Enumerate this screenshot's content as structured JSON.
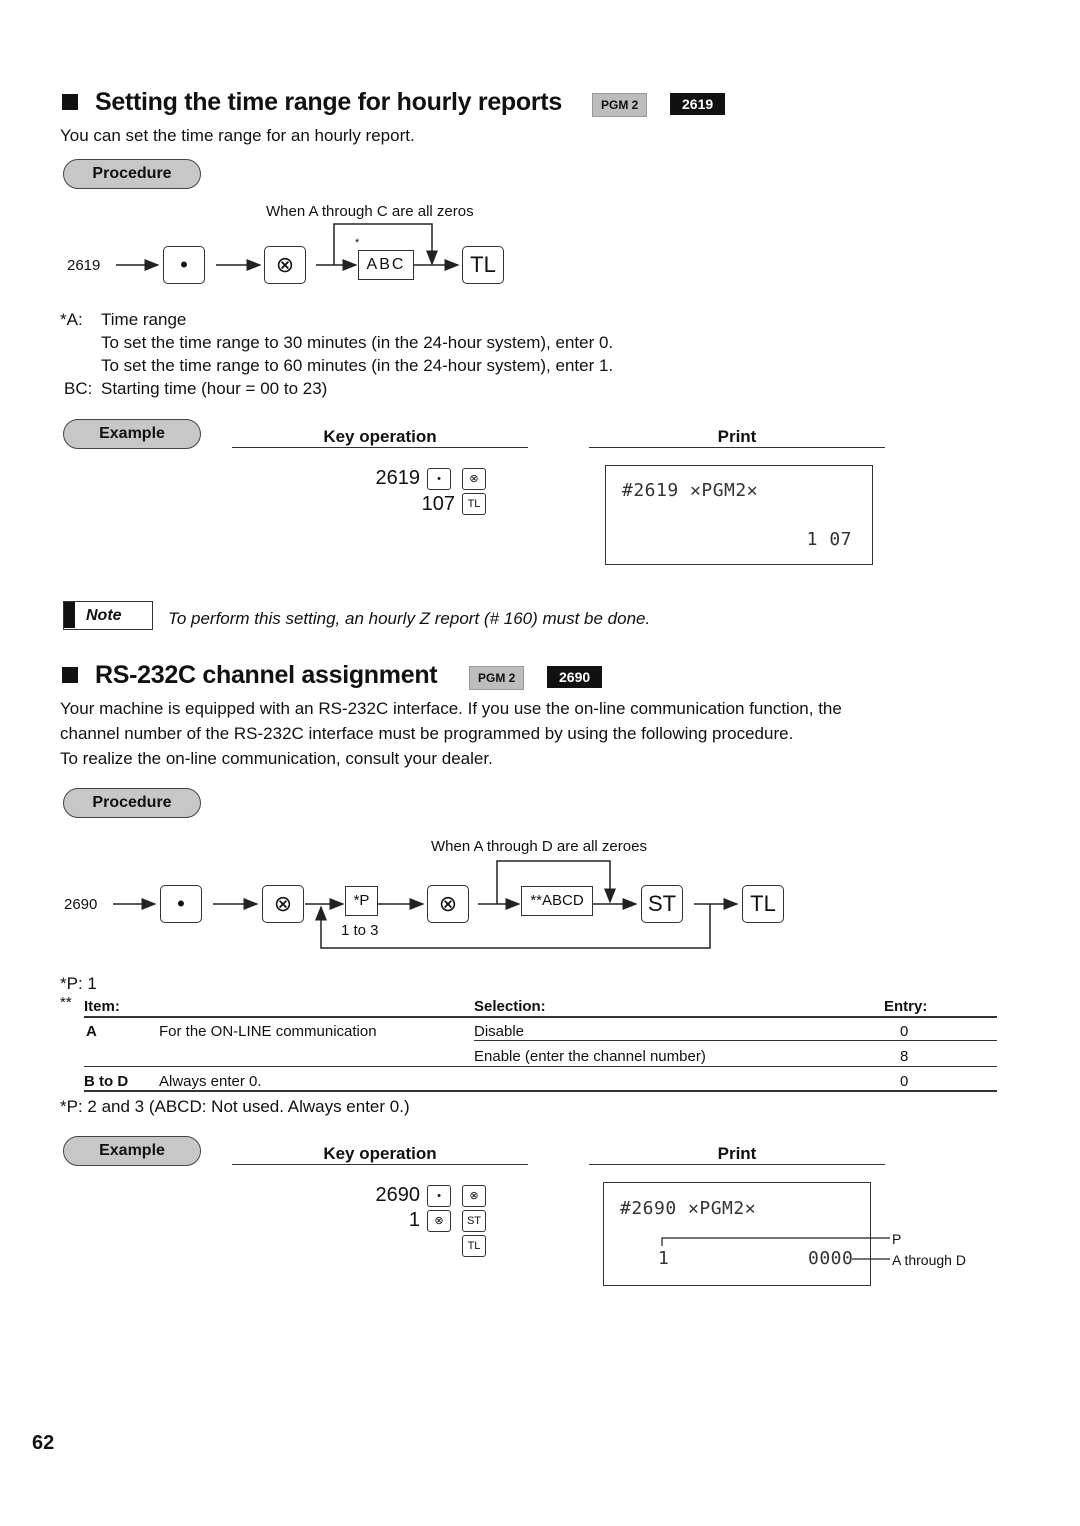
{
  "section1": {
    "title": "Setting the time range for hourly reports",
    "tag_mode": "PGM 2",
    "tag_code": "2619",
    "intro": "You can set the time range for an hourly report.",
    "procedure_label": "Procedure",
    "flow": {
      "bypass_label": "When A through C are all zeros",
      "start": "2619",
      "key1": "•",
      "key2": "⊗",
      "asterisk": "*",
      "entry": "ABC",
      "key3": "TL"
    },
    "notes": [
      {
        "label": "*A:",
        "text": "Time range"
      },
      {
        "label": "",
        "text": "To set the time range to 30 minutes (in the 24-hour system), enter 0."
      },
      {
        "label": "",
        "text": "To set the time range to 60 minutes (in the 24-hour system), enter 1."
      },
      {
        "label": "BC:",
        "text": "Starting time (hour = 00 to 23)"
      }
    ],
    "example": {
      "label": "Example",
      "key_op_header": "Key operation",
      "print_header": "Print",
      "key_lines": [
        {
          "value": "2619",
          "keys": [
            "•",
            "⊗"
          ]
        },
        {
          "value": "107",
          "keys": [
            "TL"
          ]
        }
      ],
      "print_line1": "#2619 ✕PGM2✕",
      "print_line2": "1 07"
    },
    "note_label": "Note",
    "note_text": "To perform this setting, an hourly Z report (# 160) must be done."
  },
  "section2": {
    "title": "RS-232C channel assignment",
    "tag_mode": "PGM 2",
    "tag_code": "2690",
    "intro_lines": [
      "Your machine is equipped with an RS-232C interface. If you use the on-line communication function, the",
      "channel number of the RS-232C interface must be programmed by using the following procedure.",
      "To realize the on-line communication, consult your dealer."
    ],
    "procedure_label": "Procedure",
    "flow": {
      "bypass_label": "When A through D are all zeroes",
      "start": "2690",
      "key1": "•",
      "key2": "⊗",
      "entry1": "*P",
      "entry1_range": "1 to 3",
      "key3": "⊗",
      "entry2": "**ABCD",
      "key4": "ST",
      "key5": "TL"
    },
    "p1_label": "*P: 1",
    "table_marker": "**",
    "table": {
      "headers": {
        "item": "Item:",
        "selection": "Selection:",
        "entry": "Entry:"
      },
      "rows": [
        {
          "item": "A",
          "desc": "For the ON-LINE communication",
          "selection": "Disable",
          "entry": "0"
        },
        {
          "item": "",
          "desc": "",
          "selection": "Enable (enter the channel number)",
          "entry": "8"
        },
        {
          "item": "B to D",
          "desc": "Always enter 0.",
          "selection": "",
          "entry": "0"
        }
      ]
    },
    "p23_note": "*P: 2 and 3 (ABCD: Not used. Always enter 0.)",
    "example": {
      "label": "Example",
      "key_op_header": "Key operation",
      "print_header": "Print",
      "key_lines": [
        {
          "value": "2690",
          "keys": [
            "•",
            "⊗"
          ]
        },
        {
          "value": "1",
          "keys": [
            "⊗",
            "ST"
          ]
        },
        {
          "value": "",
          "keys": [
            "TL"
          ]
        }
      ],
      "print_line1": "#2690 ✕PGM2✕",
      "print_p": "1",
      "print_abcd": "0000",
      "callout_p": "P",
      "callout_abcd": "A through D"
    }
  },
  "page_number": "62"
}
